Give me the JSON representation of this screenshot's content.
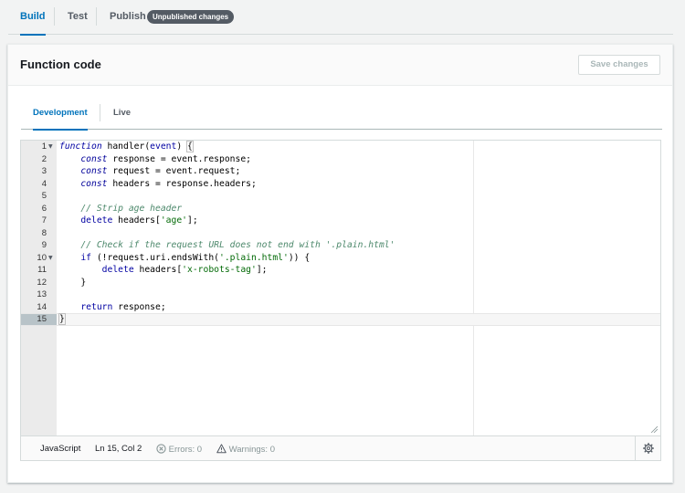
{
  "top_tabs": {
    "build": "Build",
    "test": "Test",
    "publish": "Publish",
    "badge": "Unpublished changes"
  },
  "panel": {
    "title": "Function code",
    "save_label": "Save changes"
  },
  "editor_tabs": {
    "development": "Development",
    "live": "Live"
  },
  "editor": {
    "active_line": 15,
    "lines": [
      "function handler(event) {",
      "    const response = event.response;",
      "    const request = event.request;",
      "    const headers = response.headers;",
      "",
      "    // Strip age header",
      "    delete headers['age'];",
      "",
      "    // Check if the request URL does not end with '.plain.html'",
      "    if (!request.uri.endsWith('.plain.html')) {",
      "        delete headers['x-robots-tag'];",
      "    }",
      "",
      "    return response;",
      "}"
    ],
    "line_numbers": [
      "1",
      "2",
      "3",
      "4",
      "5",
      "6",
      "7",
      "8",
      "9",
      "10",
      "11",
      "12",
      "13",
      "14",
      "15"
    ],
    "fold_markers": [
      "1",
      "10"
    ]
  },
  "status_bar": {
    "language": "JavaScript",
    "cursor": "Ln 15, Col 2",
    "errors": "Errors: 0",
    "warnings": "Warnings: 0"
  },
  "icons": {
    "errors": "x-circle-icon",
    "warnings": "warning-triangle-icon",
    "settings": "gear-icon",
    "fold": "caret-down-icon",
    "resize": "resize-grip-icon"
  },
  "colors": {
    "accent": "#0073bb",
    "badge_bg": "#545b64"
  }
}
